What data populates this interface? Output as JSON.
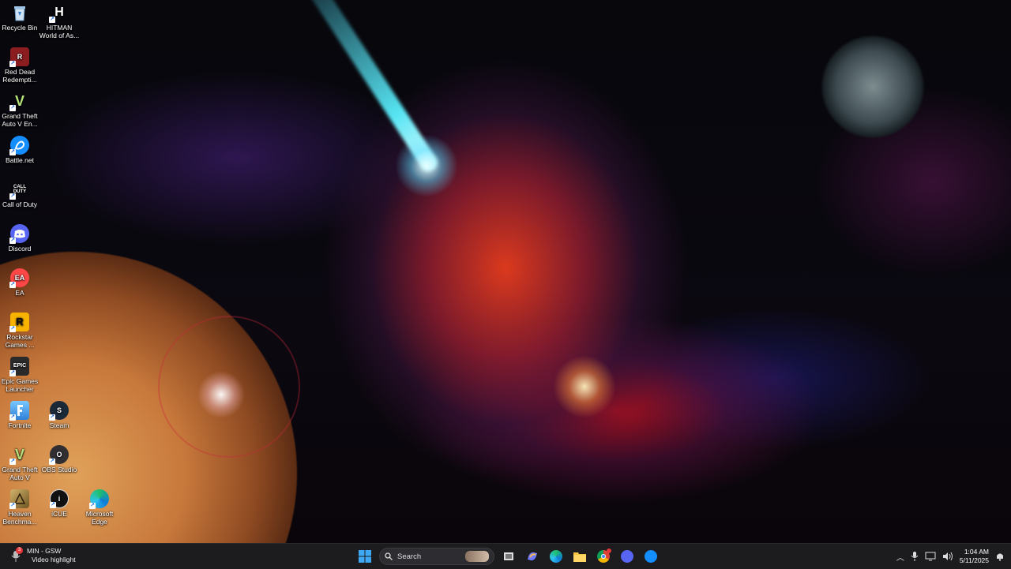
{
  "desktop": {
    "icons": [
      {
        "label": "Recycle Bin",
        "icon": "recycle-bin-icon",
        "color": "#7fb3e0"
      },
      {
        "label": "HITMAN World of As...",
        "icon": "hitman-icon",
        "color": "#dddddd"
      },
      {
        "label": "Red Dead Redempti...",
        "icon": "red-dead-icon",
        "color": "#b3262b"
      },
      {
        "label": "Grand Theft Auto V En...",
        "icon": "gta-v-icon",
        "color": "#6aa84f"
      },
      {
        "label": "Battle.net",
        "icon": "battlenet-icon",
        "color": "#148eff"
      },
      {
        "label": "Call of Duty",
        "icon": "call-of-duty-icon",
        "color": "#222222"
      },
      {
        "label": "Discord",
        "icon": "discord-icon",
        "color": "#5865f2"
      },
      {
        "label": "EA",
        "icon": "ea-icon",
        "color": "#ff4747"
      },
      {
        "label": "Rockstar Games ...",
        "icon": "rockstar-icon",
        "color": "#f8b300"
      },
      {
        "label": "Epic Games Launcher",
        "icon": "epic-games-icon",
        "color": "#2a2a2a"
      },
      {
        "label": "Fortnite",
        "icon": "fortnite-icon",
        "color": "#4fb3ff"
      },
      {
        "label": "Steam",
        "icon": "steam-icon",
        "color": "#1b2838"
      },
      {
        "label": "Grand Theft Auto V",
        "icon": "gta-v-icon",
        "color": "#6aa84f"
      },
      {
        "label": "OBS Studio",
        "icon": "obs-icon",
        "color": "#302e31"
      },
      {
        "label": "Heaven Benchma...",
        "icon": "heaven-benchmark-icon",
        "color": "#a88a4a"
      },
      {
        "label": "iCUE",
        "icon": "icue-icon",
        "color": "#111111"
      },
      {
        "label": "Microsoft Edge",
        "icon": "edge-icon",
        "color": "#0f7bd6"
      }
    ],
    "icon_glyphs": {
      "hitman": "H",
      "red_dead": "R",
      "gta": "V",
      "call_of_duty": "CALL DUTY",
      "ea": "EA",
      "rockstar": "R",
      "epic": "EPIC",
      "steam": "S",
      "obs": "O",
      "icue": "i"
    }
  },
  "taskbar": {
    "notification": {
      "title": "MIN - GSW",
      "subtitle": "Video highlight",
      "badge": "3"
    },
    "search_label": "Search",
    "clock": {
      "time": "1:04 AM",
      "date": "5/11/2025"
    },
    "colors": {
      "bar": "#1c1c1f",
      "accent": "#0078d4"
    }
  }
}
